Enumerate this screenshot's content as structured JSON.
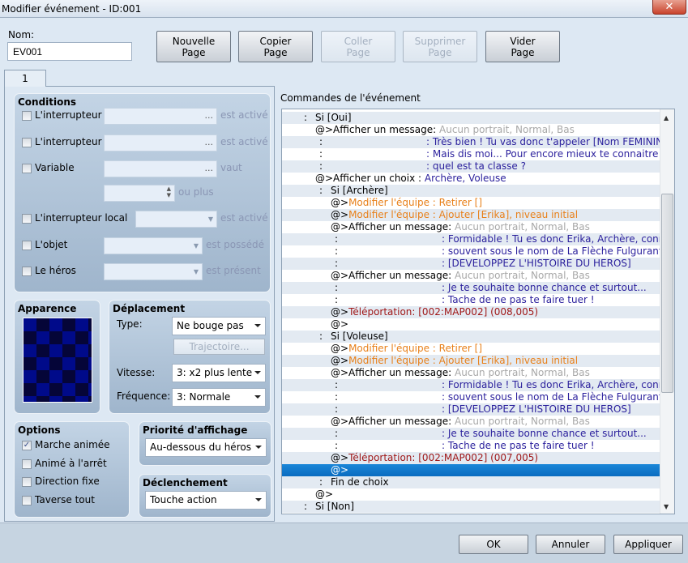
{
  "window": {
    "title": "Modifier événement - ID:001",
    "close_icon": "close-icon"
  },
  "name": {
    "label": "Nom:",
    "value": "EV001"
  },
  "toolbar": [
    {
      "label": "Nouvelle\nPage",
      "l1": "Nouvelle",
      "l2": "Page",
      "enabled": true
    },
    {
      "l1": "Copier",
      "l2": "Page",
      "enabled": true
    },
    {
      "l1": "Coller",
      "l2": "Page",
      "enabled": false
    },
    {
      "l1": "Supprimer",
      "l2": "Page",
      "enabled": false
    },
    {
      "l1": "Vider",
      "l2": "Page",
      "enabled": true
    }
  ],
  "tabs": [
    "1"
  ],
  "conditions": {
    "title": "Conditions",
    "items": [
      {
        "label": "L'interrupteur",
        "suffix": "est activé",
        "checked": false
      },
      {
        "label": "L'interrupteur",
        "suffix": "est activé",
        "checked": false
      },
      {
        "label": "Variable",
        "suffix": "vaut",
        "checked": false
      },
      {
        "label": "",
        "suffix": "ou plus"
      },
      {
        "label": "L'interrupteur local",
        "suffix": "est activé",
        "checked": false
      },
      {
        "label": "L'objet",
        "suffix": "est possédé",
        "checked": false
      },
      {
        "label": "Le héros",
        "suffix": "est présent",
        "checked": false
      }
    ],
    "ellipsis": "..."
  },
  "appearance": {
    "title": "Apparence"
  },
  "movement": {
    "title": "Déplacement",
    "type_label": "Type:",
    "type_value": "Ne bouge pas",
    "route_button": "Trajectoire...",
    "speed_label": "Vitesse:",
    "speed_value": "3: x2 plus lente",
    "freq_label": "Fréquence:",
    "freq_value": "3: Normale"
  },
  "options": {
    "title": "Options",
    "items": [
      {
        "label": "Marche animée",
        "checked": true
      },
      {
        "label": "Animé à l'arrêt",
        "checked": false
      },
      {
        "label": "Direction fixe",
        "checked": false
      },
      {
        "label": "Taverse tout",
        "checked": false
      }
    ]
  },
  "priority": {
    "title": "Priorité d'affichage",
    "value": "Au-dessous du héros"
  },
  "trigger": {
    "title": "Déclenchement",
    "value": "Touche action"
  },
  "commands": {
    "title": "Commandes de l'événement",
    "colors": {
      "black": "#000000",
      "gray": "#a8a8a8",
      "navy": "#2a1f9c",
      "orange": "#e8801a",
      "red": "#a01818"
    },
    "selected_index": 29,
    "rows": [
      {
        "kind": "branch",
        "depth": 0,
        "text": "Si [Oui]"
      },
      {
        "kind": "cmd",
        "depth": 1,
        "segs": [
          [
            "@>Afficher un message:",
            "black"
          ],
          [
            " Aucun portrait, Normal, Bas",
            "gray"
          ]
        ]
      },
      {
        "kind": "cont",
        "depth": 1,
        "text": "Très bien ! Tu vas donc t'appeler [Nom FEMININ]"
      },
      {
        "kind": "cont",
        "depth": 1,
        "text": "Mais dis moi... Pour encore mieux te connaitre"
      },
      {
        "kind": "cont",
        "depth": 1,
        "text": "quel est ta classe ?"
      },
      {
        "kind": "cmd",
        "depth": 1,
        "segs": [
          [
            "@>Afficher un choix : ",
            "black"
          ],
          [
            "Archère, Voleuse",
            "navy"
          ]
        ]
      },
      {
        "kind": "branch",
        "depth": 1,
        "text": "Si [Archère]"
      },
      {
        "kind": "cmd",
        "depth": 2,
        "segs": [
          [
            "@>",
            "black"
          ],
          [
            "Modifier l'équipe : Retirer []",
            "orange"
          ]
        ]
      },
      {
        "kind": "cmd",
        "depth": 2,
        "segs": [
          [
            "@>",
            "black"
          ],
          [
            "Modifier l'équipe : Ajouter [Erika], niveau initial",
            "orange"
          ]
        ]
      },
      {
        "kind": "cmd",
        "depth": 2,
        "segs": [
          [
            "@>Afficher un message:",
            "black"
          ],
          [
            " Aucun portrait, Normal, Bas",
            "gray"
          ]
        ]
      },
      {
        "kind": "cont",
        "depth": 2,
        "text": "Formidable ! Tu es donc Erika, Archère, connue"
      },
      {
        "kind": "cont",
        "depth": 2,
        "text": "souvent sous le nom de La Flèche Fulgurante"
      },
      {
        "kind": "cont",
        "depth": 2,
        "text": "[DEVELOPPEZ L'HISTOIRE DU HEROS]"
      },
      {
        "kind": "cmd",
        "depth": 2,
        "segs": [
          [
            "@>Afficher un message:",
            "black"
          ],
          [
            " Aucun portrait, Normal, Bas",
            "gray"
          ]
        ]
      },
      {
        "kind": "cont",
        "depth": 2,
        "text": "Je te souhaite bonne chance et surtout..."
      },
      {
        "kind": "cont",
        "depth": 2,
        "text": "Tache de ne pas te faire tuer !"
      },
      {
        "kind": "cmd",
        "depth": 2,
        "segs": [
          [
            "@>",
            "black"
          ],
          [
            "Téléportation: [002:MAP002] (008,005)",
            "red"
          ]
        ]
      },
      {
        "kind": "cmd",
        "depth": 2,
        "segs": [
          [
            "@>",
            "black"
          ]
        ]
      },
      {
        "kind": "branch",
        "depth": 1,
        "text": "Si [Voleuse]"
      },
      {
        "kind": "cmd",
        "depth": 2,
        "segs": [
          [
            "@>",
            "black"
          ],
          [
            "Modifier l'équipe : Retirer []",
            "orange"
          ]
        ]
      },
      {
        "kind": "cmd",
        "depth": 2,
        "segs": [
          [
            "@>",
            "black"
          ],
          [
            "Modifier l'équipe : Ajouter [Erika], niveau initial",
            "orange"
          ]
        ]
      },
      {
        "kind": "cmd",
        "depth": 2,
        "segs": [
          [
            "@>Afficher un message:",
            "black"
          ],
          [
            " Aucun portrait, Normal, Bas",
            "gray"
          ]
        ]
      },
      {
        "kind": "cont",
        "depth": 2,
        "text": "Formidable ! Tu es donc Erika, Archère, connue"
      },
      {
        "kind": "cont",
        "depth": 2,
        "text": "souvent sous le nom de La Flèche Fulgurante"
      },
      {
        "kind": "cont",
        "depth": 2,
        "text": "[DEVELOPPEZ L'HISTOIRE DU HEROS]"
      },
      {
        "kind": "cmd",
        "depth": 2,
        "segs": [
          [
            "@>Afficher un message:",
            "black"
          ],
          [
            " Aucun portrait, Normal, Bas",
            "gray"
          ]
        ]
      },
      {
        "kind": "cont",
        "depth": 2,
        "text": "Je te souhaite bonne chance et surtout..."
      },
      {
        "kind": "cont",
        "depth": 2,
        "text": "Tache de ne pas te faire tuer !"
      },
      {
        "kind": "cmd",
        "depth": 2,
        "segs": [
          [
            "@>",
            "black"
          ],
          [
            "Téléportation: [002:MAP002] (007,005)",
            "red"
          ]
        ]
      },
      {
        "kind": "cmd",
        "depth": 2,
        "segs": [
          [
            "@>",
            "black"
          ]
        ]
      },
      {
        "kind": "branch",
        "depth": 1,
        "text": "Fin de choix"
      },
      {
        "kind": "cmd",
        "depth": 1,
        "segs": [
          [
            "@>",
            "black"
          ]
        ]
      },
      {
        "kind": "branch",
        "depth": 0,
        "text": "Si [Non]"
      }
    ]
  },
  "footer": {
    "ok": "OK",
    "cancel": "Annuler",
    "apply": "Appliquer"
  }
}
